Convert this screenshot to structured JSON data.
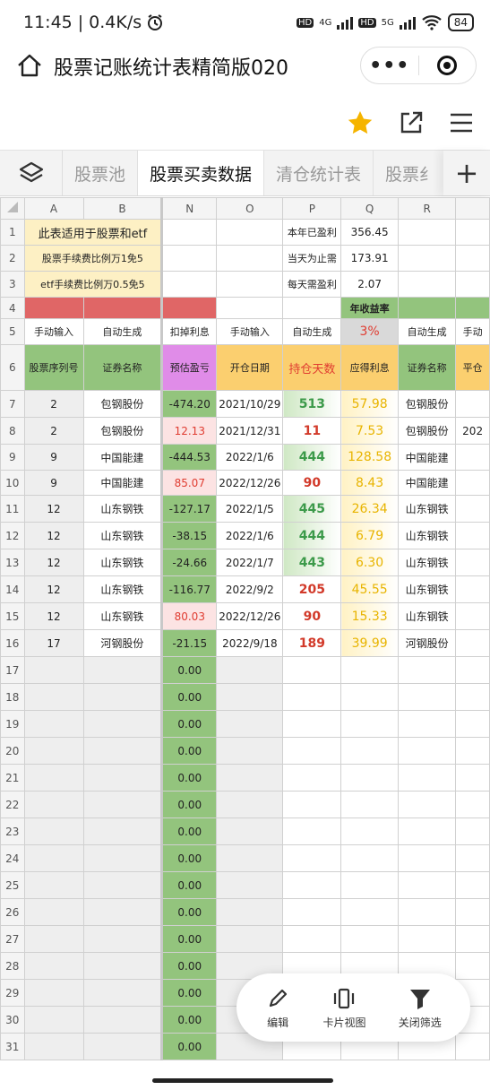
{
  "status": {
    "time": "11:45",
    "speed": "0.4K/s",
    "net1": "4G",
    "net2": "5G",
    "battery": "84"
  },
  "title": "股票记账统计表精简版020",
  "tabs": [
    "股票池",
    "股票买卖数据",
    "清仓统计表",
    "股票纟"
  ],
  "columns": [
    "A",
    "B",
    "N",
    "O",
    "P",
    "Q",
    "R",
    ""
  ],
  "colors": {
    "yellow": "#fdf0c4",
    "red": "#e06666",
    "green": "#93c47d",
    "purple": "#e08ce8",
    "orange": "#fbcf6f",
    "light_green": "#d9ead3",
    "pink": "#fce3e3"
  },
  "rows": [
    {
      "n": "1",
      "cells": [
        "此表适用于股票和etf",
        "",
        "",
        "",
        "本年已盈利",
        "356.45",
        "",
        ""
      ]
    },
    {
      "n": "2",
      "cells": [
        "股票手续费比例万1免5",
        "",
        "",
        "",
        "当天为止需",
        "173.91",
        "",
        ""
      ]
    },
    {
      "n": "3",
      "cells": [
        "etf手续费比例万0.5免5",
        "",
        "",
        "",
        "每天需盈利",
        "2.07",
        "",
        ""
      ]
    },
    {
      "n": "4",
      "cells": [
        "",
        "",
        "",
        "",
        "",
        "年收益率",
        "",
        ""
      ]
    },
    {
      "n": "5",
      "cells": [
        "手动输入",
        "自动生成",
        "扣掉利息",
        "手动输入",
        "自动生成",
        "3%",
        "自动生成",
        "手动"
      ]
    },
    {
      "n": "6",
      "cells": [
        "股票序列号",
        "证券名称",
        "预估盈亏",
        "开仓日期",
        "持仓天数",
        "应得利息",
        "证券名称",
        "平仓"
      ]
    },
    {
      "n": "7",
      "cells": [
        "2",
        "包钢股份",
        "-474.20",
        "2021/10/29",
        "513",
        "57.98",
        "包钢股份",
        ""
      ]
    },
    {
      "n": "8",
      "cells": [
        "2",
        "包钢股份",
        "12.13",
        "2021/12/31",
        "11",
        "7.53",
        "包钢股份",
        "202"
      ]
    },
    {
      "n": "9",
      "cells": [
        "9",
        "中国能建",
        "-444.53",
        "2022/1/6",
        "444",
        "128.58",
        "中国能建",
        ""
      ]
    },
    {
      "n": "10",
      "cells": [
        "9",
        "中国能建",
        "85.07",
        "2022/12/26",
        "90",
        "8.43",
        "中国能建",
        ""
      ]
    },
    {
      "n": "11",
      "cells": [
        "12",
        "山东钢铁",
        "-127.17",
        "2022/1/5",
        "445",
        "26.34",
        "山东钢铁",
        ""
      ]
    },
    {
      "n": "12",
      "cells": [
        "12",
        "山东钢铁",
        "-38.15",
        "2022/1/6",
        "444",
        "6.79",
        "山东钢铁",
        ""
      ]
    },
    {
      "n": "13",
      "cells": [
        "12",
        "山东钢铁",
        "-24.66",
        "2022/1/7",
        "443",
        "6.30",
        "山东钢铁",
        ""
      ]
    },
    {
      "n": "14",
      "cells": [
        "12",
        "山东钢铁",
        "-116.77",
        "2022/9/2",
        "205",
        "45.55",
        "山东钢铁",
        ""
      ]
    },
    {
      "n": "15",
      "cells": [
        "12",
        "山东钢铁",
        "80.03",
        "2022/12/26",
        "90",
        "15.33",
        "山东钢铁",
        ""
      ]
    },
    {
      "n": "16",
      "cells": [
        "17",
        "河钢股份",
        "-21.15",
        "2022/9/18",
        "189",
        "39.99",
        "河钢股份",
        ""
      ]
    }
  ],
  "empty_rows": [
    "17",
    "18",
    "19",
    "20",
    "21",
    "22",
    "23",
    "24",
    "25",
    "26",
    "27",
    "28",
    "29",
    "30",
    "31"
  ],
  "empty_value": "0.00",
  "fab": {
    "edit": "编辑",
    "card": "卡片视图",
    "filter": "关闭筛选"
  }
}
